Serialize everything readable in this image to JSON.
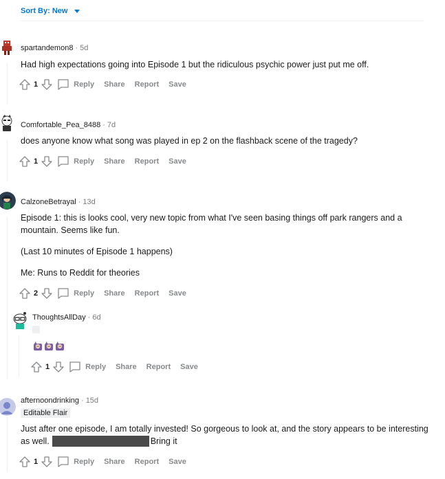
{
  "sort": {
    "label": "Sort By: New"
  },
  "comments": [
    {
      "author": "spartandemon8",
      "age": "5d",
      "text": "Had high expectations going into Episode 1 but the ridiculous psychic power just put me off.",
      "score": "1",
      "reply": "Reply",
      "share": "Share",
      "report": "Report",
      "save": "Save"
    },
    {
      "author": "Comfortable_Pea_8488",
      "age": "7d",
      "text": "does anyone know what song was played in ep 2 on the flashback scene of the tragedy?",
      "score": "1",
      "reply": "Reply",
      "share": "Share",
      "report": "Report",
      "save": "Save"
    },
    {
      "author": "CalzoneBetrayal",
      "age": "13d",
      "p1": "Episode 1: this is looks cool, very new topic from what I've seen basing things off park rangers and a mountain. Seems like fun.",
      "p2": "(Last 10 minutes of Episode 1 happens)",
      "p3": "Me: Runs to Reddit for theories",
      "score": "2",
      "reply": "Reply",
      "share": "Share",
      "report": "Report",
      "save": "Save"
    },
    {
      "author": "ThoughtsAllDay",
      "age": "6d",
      "score": "1",
      "reply": "Reply",
      "share": "Share",
      "report": "Report",
      "save": "Save"
    },
    {
      "author": "afternoondrinking",
      "age": "15d",
      "flair": "Editable Flair",
      "text_before": "Just after one episode, I am totally invested! So gorgeous to look at, and the story appears to be interesting as well.",
      "text_after": "Bring it",
      "score": "1",
      "reply": "Reply",
      "share": "Share",
      "report": "Report",
      "save": "Save"
    }
  ],
  "separator": "·"
}
